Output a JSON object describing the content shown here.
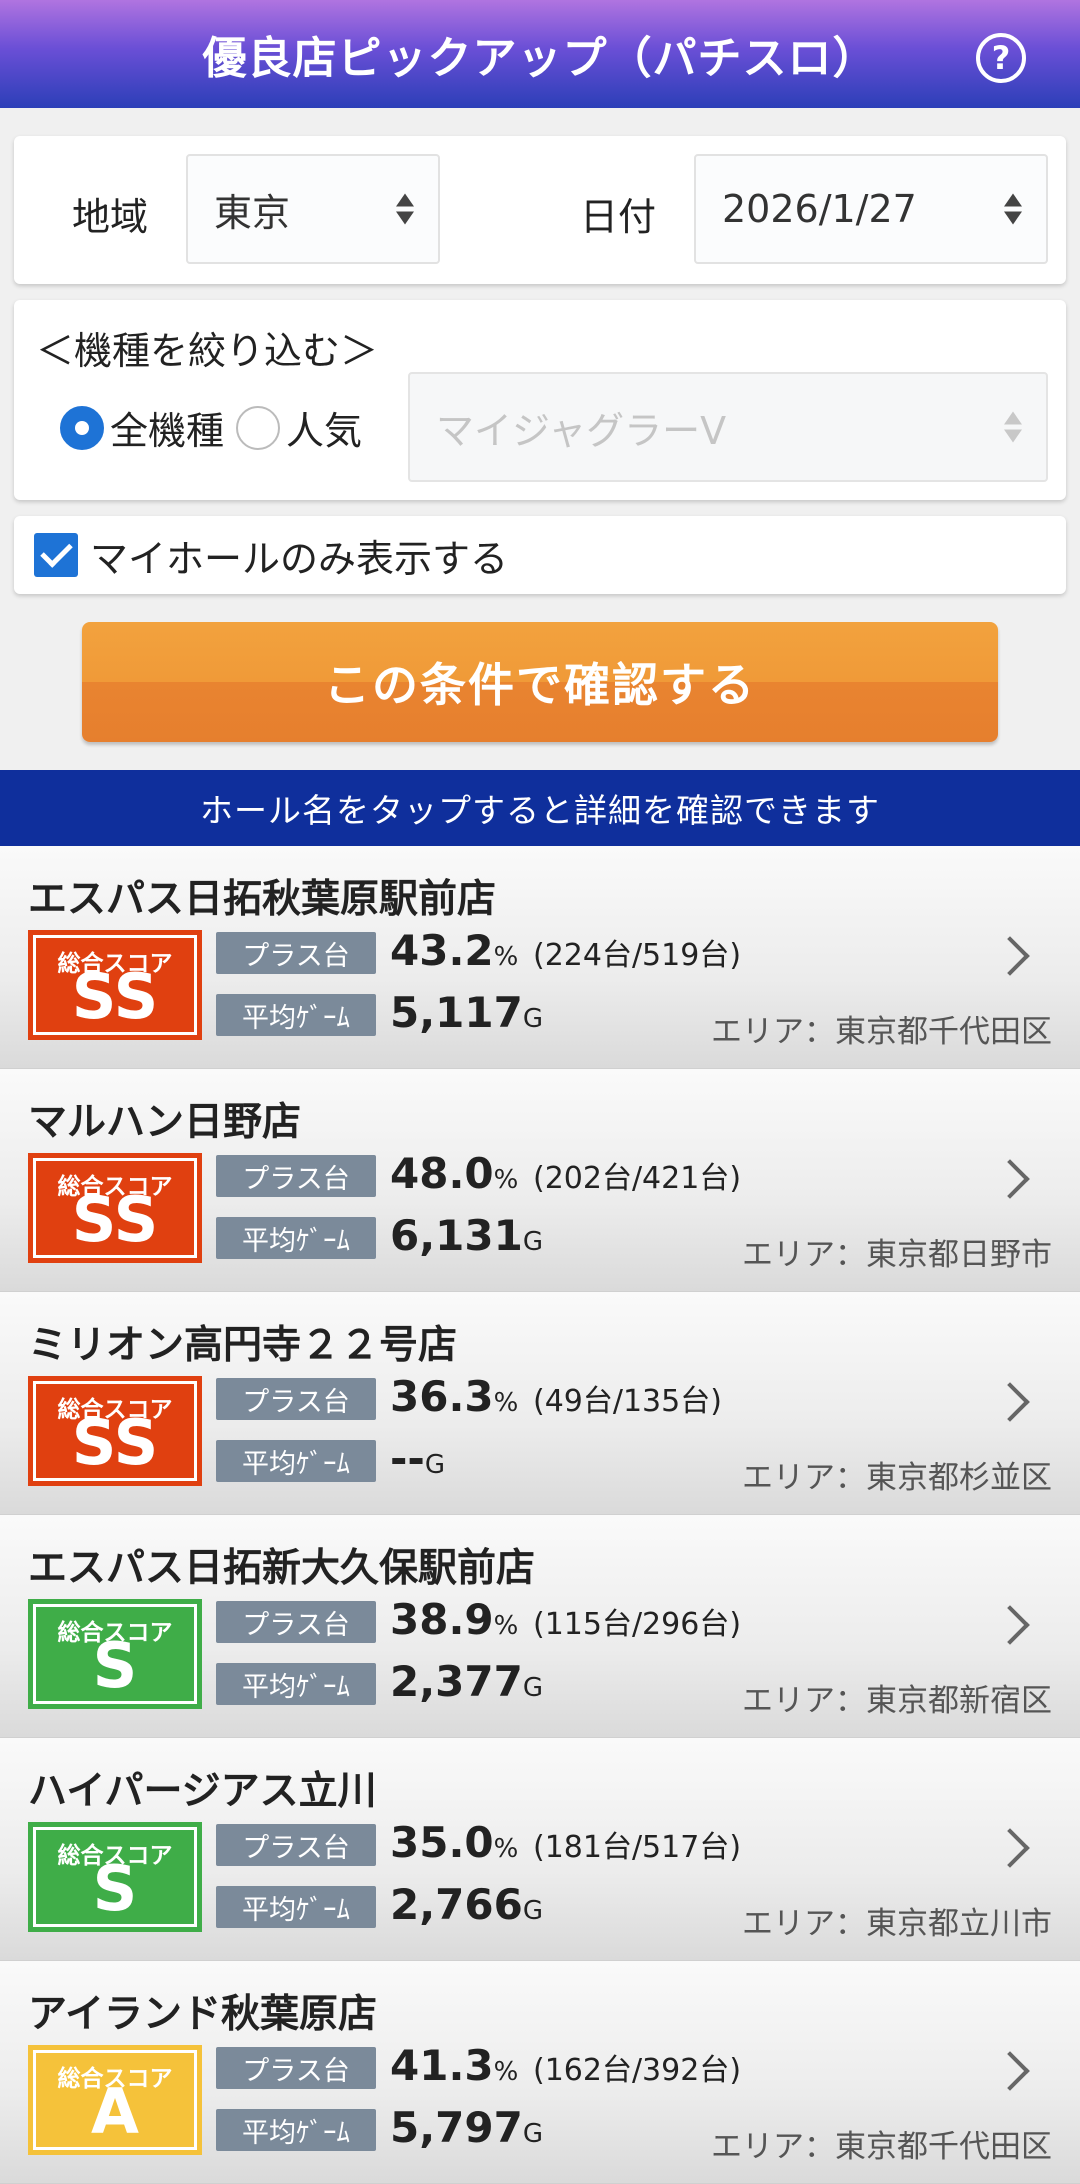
{
  "header": {
    "title": "優良店ピックアップ（パチスロ）",
    "help_icon": "?"
  },
  "filters": {
    "region_label": "地域",
    "region_value": "東京",
    "date_label": "日付",
    "date_value": "2026/1/27",
    "model_heading": "＜機種を絞り込む＞",
    "radio_all": "全機種",
    "radio_popular": "人気",
    "radio_selected": "全機種",
    "model_select": "マイジャグラーV",
    "myhall_label": "マイホールのみ表示する",
    "myhall_checked": true
  },
  "confirm_button": "この条件で確認する",
  "notice": "ホール名をタップすると詳細を確認できます",
  "labels": {
    "score_top": "総合スコア",
    "plus_tag": "プラス台",
    "avg_tag": "平均ｹﾞｰﾑ",
    "percent_unit": "%",
    "game_unit": "G"
  },
  "halls": [
    {
      "name": "エスパス日拓秋葉原駅前店",
      "rank": "SS",
      "plus_rate": "43.2",
      "plus_count": "(224台/519台)",
      "avg_game": "5,117",
      "area": "エリア：東京都千代田区"
    },
    {
      "name": "マルハン日野店",
      "rank": "SS",
      "plus_rate": "48.0",
      "plus_count": "(202台/421台)",
      "avg_game": "6,131",
      "area": "エリア：東京都日野市"
    },
    {
      "name": "ミリオン高円寺２２号店",
      "rank": "SS",
      "plus_rate": "36.3",
      "plus_count": "(49台/135台)",
      "avg_game": "--",
      "area": "エリア：東京都杉並区"
    },
    {
      "name": "エスパス日拓新大久保駅前店",
      "rank": "S",
      "plus_rate": "38.9",
      "plus_count": "(115台/296台)",
      "avg_game": "2,377",
      "area": "エリア：東京都新宿区"
    },
    {
      "name": "ハイパージアス立川",
      "rank": "S",
      "plus_rate": "35.0",
      "plus_count": "(181台/517台)",
      "avg_game": "2,766",
      "area": "エリア：東京都立川市"
    },
    {
      "name": "アイランド秋葉原店",
      "rank": "A",
      "plus_rate": "41.3",
      "plus_count": "(162台/392台)",
      "avg_game": "5,797",
      "area": "エリア：東京都千代田区"
    }
  ],
  "colors": {
    "rank_SS": "#e04010",
    "rank_S": "#3fad48",
    "rank_A": "#f5c23a",
    "accent_blue": "#1e73d6",
    "notice_bg": "#0f2f9c",
    "button_orange": "#f09a38"
  }
}
